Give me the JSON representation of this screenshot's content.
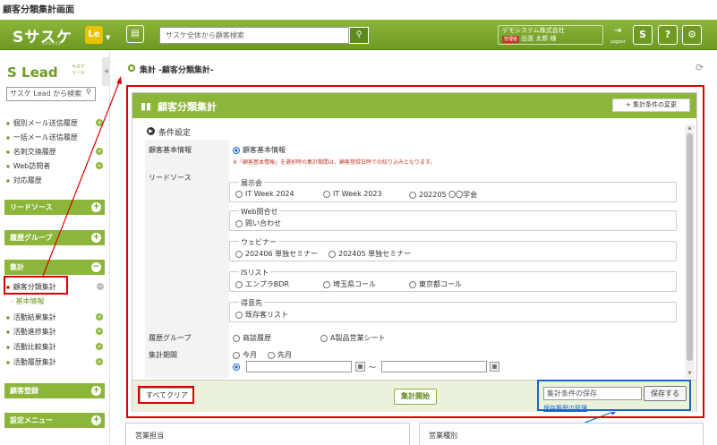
{
  "page_title": "顧客分類集計画面",
  "topbar": {
    "logo": "Sサスケ",
    "logo_sub": "SASUKE",
    "le_label": "Le",
    "search_placeholder": "サスケ全体から顧客検索",
    "company": "デモシステム株式会社",
    "user_badge": "管理者",
    "user_name": "出張 太郎 様",
    "logout_label": "Logout",
    "s_button": "S",
    "help_button": "?",
    "settings_button": "⚙"
  },
  "sidebar": {
    "logo": "S Lead",
    "logo_sub_1": "サスケ",
    "logo_sub_2": "リード",
    "search_value": "サスケ Lead から検索",
    "history_items": [
      "個別メール送信履歴",
      "一括メール送信履歴",
      "名刺交換履歴",
      "Web訪問者",
      "対応履歴"
    ],
    "sections": {
      "lead_source": "リードソース",
      "history_group": "履歴グループ",
      "aggregate": "集計",
      "customer_register": "顧客登録",
      "settings_menu": "設定メニュー"
    },
    "aggregate_items": {
      "customer_class": "顧客分類集計",
      "basic_info": "基本情報",
      "activity_result": "活動結果集計",
      "activity_progress": "活動進捗集計",
      "activity_compare": "活動比較集計",
      "activity_history": "活動履歴集計"
    }
  },
  "main": {
    "breadcrumb": "集計 -顧客分類集計-",
    "panel_title": "顧客分類集計",
    "change_button": "+ 集計条件の変更",
    "condition_title": "条件設定",
    "rows": {
      "customer_basic": {
        "label": "顧客基本情報",
        "option": "顧客基本情報",
        "note": "※「顧客基本情報」を選択時の集計期間は、顧客登録日時での絞り込みとなります。"
      },
      "lead_source": {
        "label": "リードソース",
        "groups": [
          {
            "legend": "展示会",
            "options": [
              "IT Week 2024",
              "IT Week 2023",
              "202205 〇〇学会"
            ]
          },
          {
            "legend": "Web問合せ",
            "options": [
              "問い合わせ"
            ]
          },
          {
            "legend": "ウェビナー",
            "options": [
              "202406 単独セミナー",
              "202405 単独セミナー"
            ]
          },
          {
            "legend": "ISリスト",
            "options": [
              "エンプラBDR",
              "埼玉県コール",
              "東京都コール"
            ]
          },
          {
            "legend": "得意先",
            "options": [
              "既存客リスト"
            ]
          }
        ]
      },
      "history_group": {
        "label": "履歴グループ",
        "options": [
          "商談履歴",
          "A製品営業シート"
        ]
      },
      "period": {
        "label": "集計期間",
        "options": [
          "今月",
          "先月"
        ],
        "tilde": "～"
      }
    },
    "footer": {
      "clear_button": "すべてクリア",
      "run_button": "集計開始",
      "save_placeholder": "集計条件の保存",
      "save_button": "保存する",
      "history_link": "保存履歴の管理"
    },
    "bottom_cards": [
      "営業担当",
      "営業種別"
    ]
  }
}
